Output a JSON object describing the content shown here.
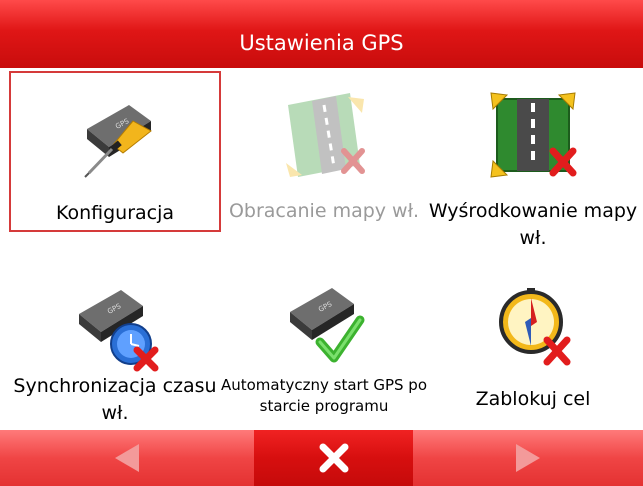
{
  "header": {
    "title": "Ustawienia GPS"
  },
  "tiles": [
    {
      "label": "Konfiguracja",
      "icon": "gps-configure-icon",
      "state": "selected"
    },
    {
      "label": "Obracanie mapy wł.",
      "icon": "rotate-map-icon",
      "state": "disabled"
    },
    {
      "label": "Wyśrodkowanie mapy wł.",
      "icon": "center-map-icon",
      "state": "normal"
    },
    {
      "label": "Synchronizacja czasu wł.",
      "icon": "sync-time-icon",
      "state": "normal"
    },
    {
      "label": "Automatyczny start GPS po starcie programu",
      "icon": "gps-autostart-icon",
      "state": "normal"
    },
    {
      "label": "Zablokuj cel",
      "icon": "lock-target-icon",
      "state": "normal"
    }
  ],
  "footer": {
    "left": {
      "icon": "arrow-left-icon",
      "state": "disabled"
    },
    "center": {
      "icon": "close-icon"
    },
    "right": {
      "icon": "arrow-right-icon",
      "state": "disabled"
    }
  },
  "colors": {
    "header": "#e01616",
    "selection_border": "#d53a3a",
    "disabled_text": "#9a9a9a",
    "footer_side": "#f04545",
    "footer_center": "#d70f0f"
  }
}
